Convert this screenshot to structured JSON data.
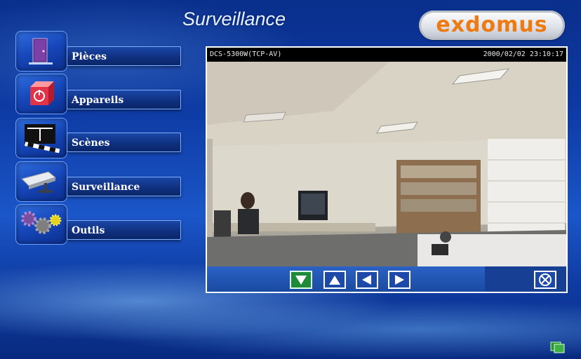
{
  "page": {
    "title": "Surveillance"
  },
  "logo": {
    "text": "exdomus"
  },
  "sidebar": {
    "items": [
      {
        "label": "Pièces",
        "icon": "door-icon"
      },
      {
        "label": "Appareils",
        "icon": "power-box-icon"
      },
      {
        "label": "Scènes",
        "icon": "scene-barrier-icon"
      },
      {
        "label": "Surveillance",
        "icon": "camera-icon"
      },
      {
        "label": "Outils",
        "icon": "gears-icon"
      }
    ]
  },
  "camera": {
    "name": "DCS-5300W(TCP-AV)",
    "timestamp": "2000/02/02 23:10:17",
    "controls": [
      "tilt-down",
      "tilt-up",
      "pan-left",
      "pan-right",
      "close"
    ]
  },
  "colors": {
    "accent_logo": "#ee7a12",
    "active_control": "#1f8a3a",
    "panel": "#1c4da8"
  }
}
